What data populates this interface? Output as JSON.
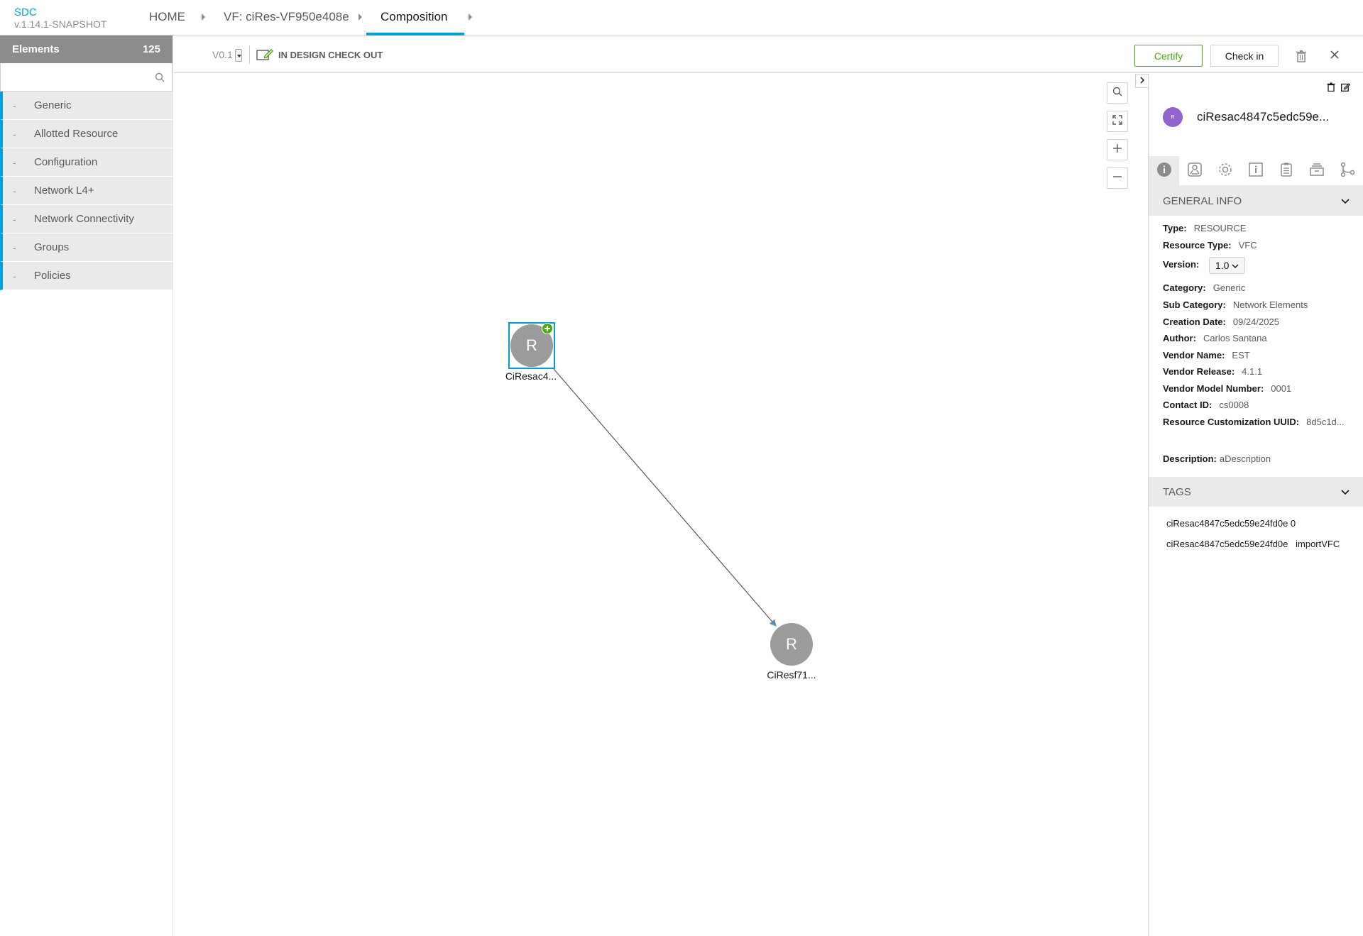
{
  "header": {
    "app_name": "SDC",
    "app_version": "v.1.14.1-SNAPSHOT",
    "breadcrumbs": [
      "HOME",
      "VF: ciRes-VF950e408e",
      "Composition"
    ]
  },
  "sidebar": {
    "title": "Elements",
    "count": "125",
    "search_placeholder": "",
    "groups": [
      {
        "dash": "-",
        "label": "Generic"
      },
      {
        "dash": "-",
        "label": "Allotted Resource"
      },
      {
        "dash": "-",
        "label": "Configuration"
      },
      {
        "dash": "-",
        "label": "Network L4+"
      },
      {
        "dash": "-",
        "label": "Network Connectivity"
      },
      {
        "dash": "-",
        "label": "Groups"
      },
      {
        "dash": "-",
        "label": "Policies"
      }
    ]
  },
  "toolbar": {
    "version": "V0.1",
    "status": "IN DESIGN CHECK OUT",
    "certify_label": "Certify",
    "checkin_label": "Check in"
  },
  "canvas": {
    "nodes": [
      {
        "letter": "R",
        "label": "CiResac4..."
      },
      {
        "letter": "R",
        "label": "CiResf71..."
      }
    ]
  },
  "panel": {
    "avatar_letter": "R",
    "component_name": "ciResac4847c5edc59e...",
    "general_info_title": "GENERAL INFO",
    "info": {
      "type_k": "Type:",
      "type_v": "RESOURCE",
      "rtype_k": "Resource Type:",
      "rtype_v": "VFC",
      "version_k": "Version:",
      "version_v": "1.0",
      "category_k": "Category:",
      "category_v": "Generic",
      "subcat_k": "Sub Category:",
      "subcat_v": "Network Elements",
      "created_k": "Creation Date:",
      "created_v": "09/24/2025",
      "author_k": "Author:",
      "author_v": "Carlos Santana",
      "vendor_k": "Vendor Name:",
      "vendor_v": "EST",
      "vrel_k": "Vendor Release:",
      "vrel_v": "4.1.1",
      "vmodel_k": "Vendor Model Number:",
      "vmodel_v": "0001",
      "contact_k": "Contact ID:",
      "contact_v": "cs0008",
      "uuid_k": "Resource Customization UUID:",
      "uuid_v": "8d5c1d...",
      "desc_k": "Description:",
      "desc_v": "aDescription"
    },
    "tags_title": "TAGS",
    "tags": [
      "ciResac4847c5edc59e24fd0e 0",
      "ciResac4847c5edc59e24fd0e   importVFC"
    ]
  },
  "colors": {
    "accent": "#009fdb",
    "certify": "#4ca90c",
    "avatar": "#9063cd",
    "node": "#9b9b9b"
  }
}
